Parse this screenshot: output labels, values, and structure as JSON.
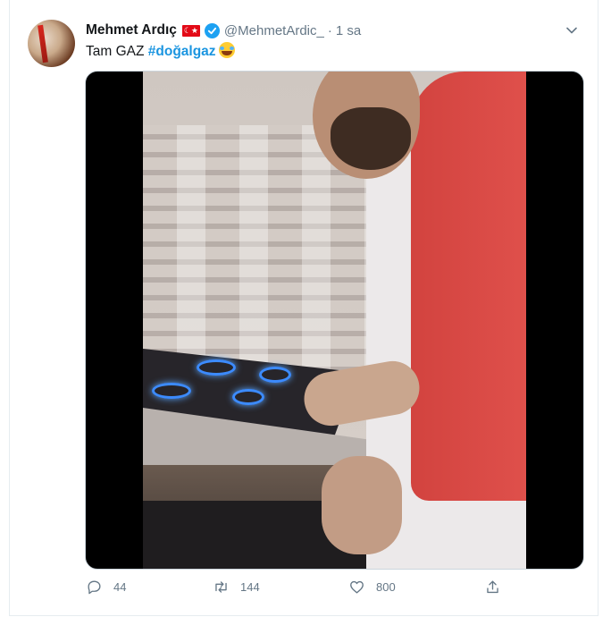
{
  "tweet": {
    "author_name": "Mehmet Ardıç",
    "flag_glyph": "☾★",
    "handle": "@MehmetArdic_",
    "separator": "·",
    "time": "1 sa",
    "text_prefix": "Tam GAZ ",
    "hashtag": "#doğalgaz",
    "emoji_name": "face-with-tears-of-joy",
    "accent_color": "#1da1f2",
    "hashtag_color": "#1b95e0"
  },
  "actions": {
    "reply_count": "44",
    "retweet_count": "144",
    "like_count": "800"
  },
  "icons": {
    "reply": "reply-icon",
    "retweet": "retweet-icon",
    "like": "heart-icon",
    "share": "share-icon",
    "menu": "chevron-down-icon",
    "verified": "verified-badge-icon"
  }
}
